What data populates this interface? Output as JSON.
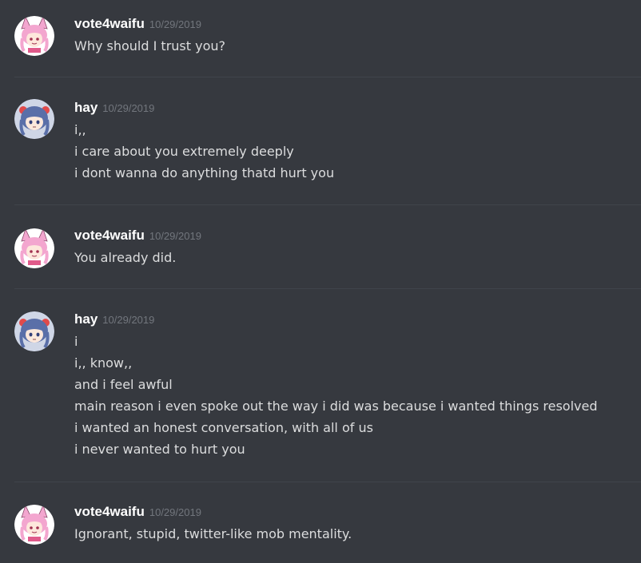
{
  "messages": [
    {
      "username": "vote4waifu",
      "timestamp": "10/29/2019",
      "avatar_icon": "pink-hair-cat-ear-girl-avatar",
      "lines": [
        "Why should I trust you?"
      ]
    },
    {
      "username": "hay",
      "timestamp": "10/29/2019",
      "avatar_icon": "blue-hair-girl-avatar",
      "lines": [
        "i,,",
        "i care about you extremely deeply",
        "i dont wanna do anything thatd hurt you"
      ]
    },
    {
      "username": "vote4waifu",
      "timestamp": "10/29/2019",
      "avatar_icon": "pink-hair-cat-ear-girl-avatar",
      "lines": [
        "You already did."
      ]
    },
    {
      "username": "hay",
      "timestamp": "10/29/2019",
      "avatar_icon": "blue-hair-girl-avatar",
      "lines": [
        "i",
        "i,, know,,",
        "and i feel awful",
        "main reason i even spoke out the way i did was because i wanted things resolved",
        "i wanted an honest conversation, with all of us",
        "i never wanted to hurt you"
      ]
    },
    {
      "username": "vote4waifu",
      "timestamp": "10/29/2019",
      "avatar_icon": "pink-hair-cat-ear-girl-avatar",
      "lines": [
        "Ignorant, stupid, twitter-like mob mentality."
      ]
    }
  ],
  "colors": {
    "background": "#36393f",
    "username": "#ffffff",
    "timestamp": "#72767d",
    "text": "#dcddde",
    "divider": "#40444b",
    "pink_hair": "#f3a6cf",
    "blue_hair": "#5a6fa8"
  }
}
